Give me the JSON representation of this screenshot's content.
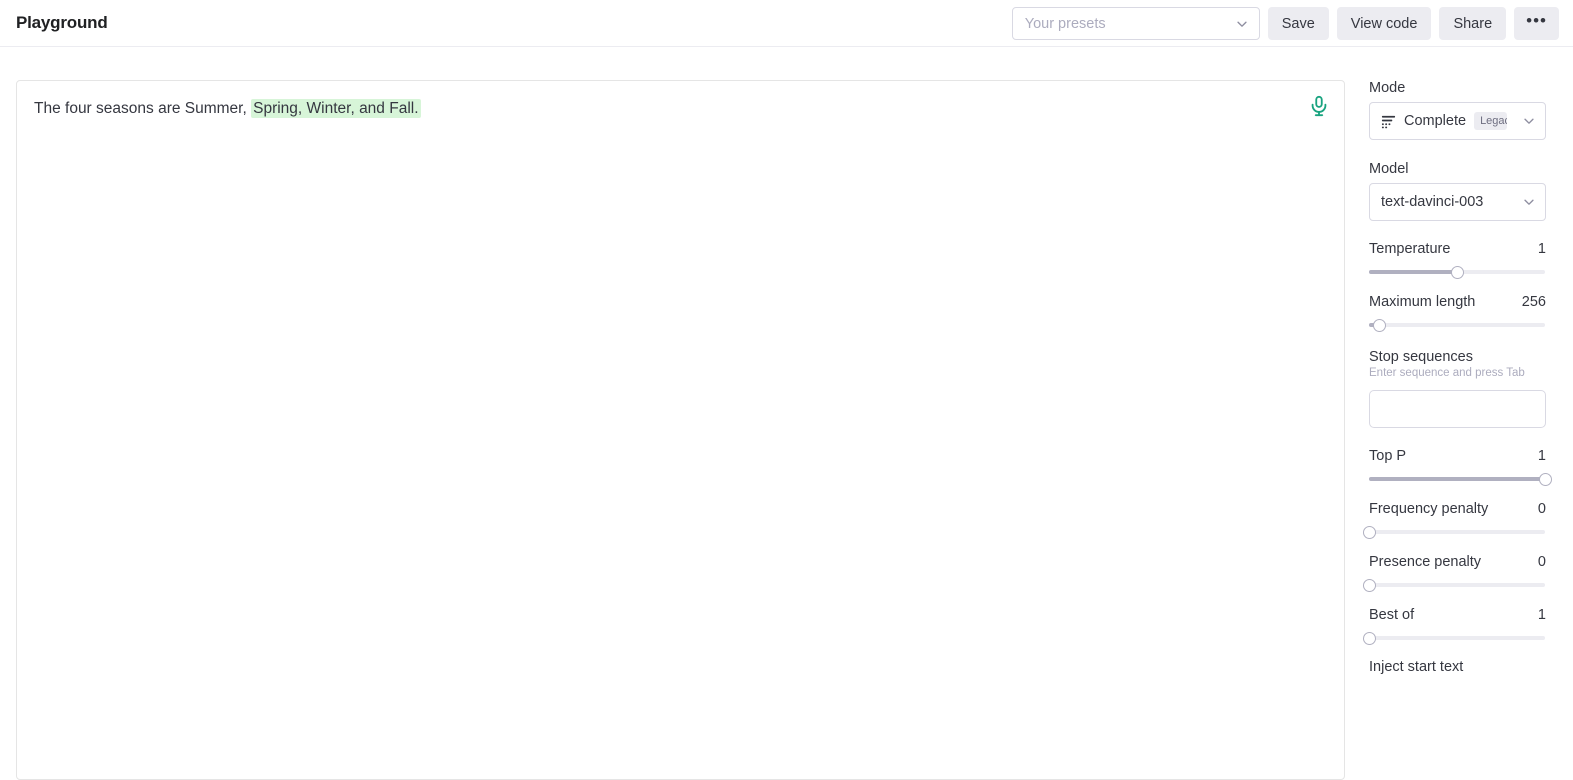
{
  "header": {
    "title": "Playground",
    "presets": {
      "placeholder": "Your presets",
      "chevron_icon": "chevron-down-icon"
    },
    "buttons": [
      {
        "label": "Save",
        "name": "save-button"
      },
      {
        "label": "View code",
        "name": "view-code-button"
      },
      {
        "label": "Share",
        "name": "share-button"
      },
      {
        "label": "•••",
        "name": "more-options-button"
      }
    ]
  },
  "prompt": {
    "text_plain": "The four seasons are Summer, ",
    "text_highlighted": "Spring, Winter, and Fall.",
    "highlight_color": "#d7f5d8",
    "mic_icon": "microphone-icon",
    "mic_color": "#19a37f"
  },
  "sidebar": {
    "mode": {
      "label": "Mode",
      "value": "Complete",
      "badge": "Legacy",
      "icon": "complete-list-icon"
    },
    "model": {
      "label": "Model",
      "value": "text-davinci-003"
    },
    "sliders": [
      {
        "label": "Temperature",
        "value": "1",
        "percent": 50,
        "name": "temperature"
      },
      {
        "label": "Maximum length",
        "value": "256",
        "percent": 6,
        "name": "maximum-length"
      },
      {
        "label": "Top P",
        "value": "1",
        "percent": 100,
        "name": "top-p"
      },
      {
        "label": "Frequency penalty",
        "value": "0",
        "percent": 0,
        "name": "frequency-penalty"
      },
      {
        "label": "Presence penalty",
        "value": "0",
        "percent": 0,
        "name": "presence-penalty"
      },
      {
        "label": "Best of",
        "value": "1",
        "percent": 0,
        "name": "best-of"
      }
    ],
    "stop_sequences": {
      "label": "Stop sequences",
      "hint": "Enter sequence and press Tab",
      "value": "",
      "placeholder": ""
    },
    "cut_off_label": "Inject start text"
  }
}
